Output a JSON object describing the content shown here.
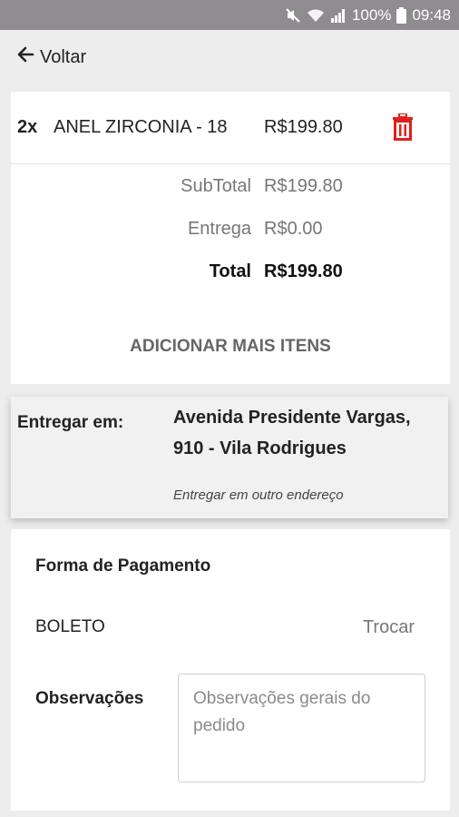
{
  "status_bar": {
    "battery": "100%",
    "time": "09:48"
  },
  "header": {
    "back_label": "Voltar"
  },
  "cart": {
    "item": {
      "qty": "2x",
      "name": "ANEL ZIRCONIA - 18",
      "price": "R$199.80"
    },
    "subtotal_label": "SubTotal",
    "subtotal_value": "R$199.80",
    "delivery_label": "Entrega",
    "delivery_value": "R$0.00",
    "total_label": "Total",
    "total_value": "R$199.80",
    "add_more_label": "ADICIONAR MAIS ITENS"
  },
  "delivery": {
    "label": "Entregar em:",
    "address": "Avenida Presidente Vargas, 910 - Vila Rodrigues",
    "other_address_label": "Entregar em outro endereço"
  },
  "payment": {
    "title": "Forma de Pagamento",
    "method": "BOLETO",
    "change_label": "Trocar",
    "observations_label": "Observações",
    "observations_placeholder": "Observações gerais do pedido"
  },
  "colors": {
    "status_bar": "#8e8c8e",
    "background": "#ededed",
    "trash_red": "#e0201c",
    "muted_text": "#777777"
  },
  "icons": [
    "mute-icon",
    "wifi-icon",
    "signal-icon",
    "battery-icon",
    "arrow-left-icon",
    "trash-icon"
  ]
}
